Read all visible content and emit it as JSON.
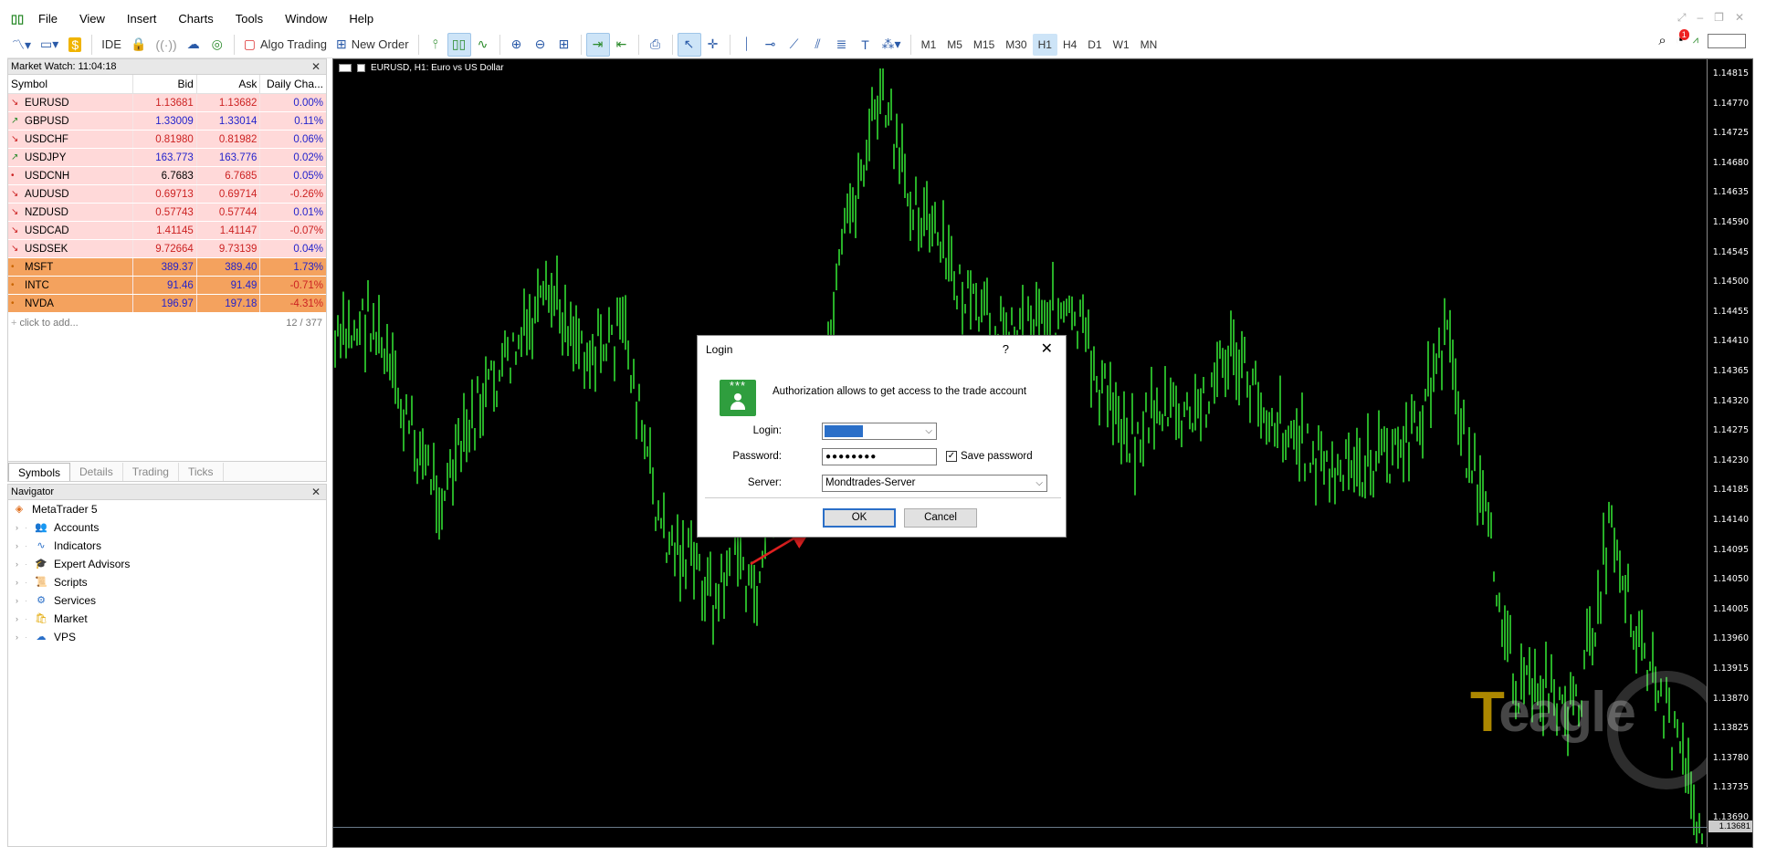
{
  "menu": [
    "File",
    "View",
    "Insert",
    "Charts",
    "Tools",
    "Window",
    "Help"
  ],
  "toolbar": {
    "ide": "IDE",
    "algo_trading": "Algo Trading",
    "new_order": "New Order",
    "timeframes": [
      "M1",
      "M5",
      "M15",
      "M30",
      "H1",
      "H4",
      "D1",
      "W1",
      "MN"
    ],
    "active_timeframe": "H1",
    "notifications": "1"
  },
  "market_watch": {
    "title": "Market Watch: 11:04:18",
    "headers": {
      "symbol": "Symbol",
      "bid": "Bid",
      "ask": "Ask",
      "change": "Daily Cha..."
    },
    "rows": [
      {
        "symbol": "EURUSD",
        "bid": "1.13681",
        "ask": "1.13682",
        "change": "0.00%",
        "dir": "down",
        "type": "fx"
      },
      {
        "symbol": "GBPUSD",
        "bid": "1.33009",
        "ask": "1.33014",
        "change": "0.11%",
        "dir": "up",
        "type": "fx"
      },
      {
        "symbol": "USDCHF",
        "bid": "0.81980",
        "ask": "0.81982",
        "change": "0.06%",
        "dir": "down",
        "type": "fx"
      },
      {
        "symbol": "USDJPY",
        "bid": "163.773",
        "ask": "163.776",
        "change": "0.02%",
        "dir": "up",
        "type": "fx"
      },
      {
        "symbol": "USDCNH",
        "bid": "6.7683",
        "ask": "6.7685",
        "change": "0.05%",
        "dir": "flat",
        "type": "fx"
      },
      {
        "symbol": "AUDUSD",
        "bid": "0.69713",
        "ask": "0.69714",
        "change": "-0.26%",
        "dir": "down",
        "type": "fx"
      },
      {
        "symbol": "NZDUSD",
        "bid": "0.57743",
        "ask": "0.57744",
        "change": "0.01%",
        "dir": "down",
        "type": "fx"
      },
      {
        "symbol": "USDCAD",
        "bid": "1.41145",
        "ask": "1.41147",
        "change": "-0.07%",
        "dir": "down",
        "type": "fx"
      },
      {
        "symbol": "USDSEK",
        "bid": "9.72664",
        "ask": "9.73139",
        "change": "0.04%",
        "dir": "down",
        "type": "fx"
      },
      {
        "symbol": "MSFT",
        "bid": "389.37",
        "ask": "389.40",
        "change": "1.73%",
        "dir": "flat",
        "type": "stock"
      },
      {
        "symbol": "INTC",
        "bid": "91.46",
        "ask": "91.49",
        "change": "-0.71%",
        "dir": "flat",
        "type": "stock"
      },
      {
        "symbol": "NVDA",
        "bid": "196.97",
        "ask": "197.18",
        "change": "-4.31%",
        "dir": "flat",
        "type": "stock"
      }
    ],
    "click_to_add": "click to add...",
    "count": "12 / 377",
    "tabs": [
      "Symbols",
      "Details",
      "Trading",
      "Ticks"
    ],
    "active_tab": "Symbols"
  },
  "navigator": {
    "title": "Navigator",
    "root": "MetaTrader 5",
    "items": [
      "Accounts",
      "Indicators",
      "Expert Advisors",
      "Scripts",
      "Services",
      "Market",
      "VPS"
    ]
  },
  "chart": {
    "title": "EURUSD, H1:  Euro vs US Dollar",
    "price_labels": [
      "1.14815",
      "1.14770",
      "1.14725",
      "1.14680",
      "1.14635",
      "1.14590",
      "1.14545",
      "1.14500",
      "1.14455",
      "1.14410",
      "1.14365",
      "1.14320",
      "1.14275",
      "1.14230",
      "1.14185",
      "1.14140",
      "1.14095",
      "1.14050",
      "1.14005",
      "1.13960",
      "1.13915",
      "1.13870",
      "1.13825",
      "1.13780",
      "1.13735",
      "1.13690"
    ],
    "current_price": "1.13681",
    "candle_color": "#33dd33",
    "watermark": "Teagle"
  },
  "login_dialog": {
    "title": "Login",
    "help": "?",
    "message": "Authorization allows to get access to the trade account",
    "login_label": "Login:",
    "password_label": "Password:",
    "password_value": "●●●●●●●●",
    "save_password": "Save password",
    "save_password_checked": true,
    "server_label": "Server:",
    "server_value": "Mondtrades-Server",
    "ok": "OK",
    "cancel": "Cancel",
    "highlight_color": "#e02020"
  }
}
